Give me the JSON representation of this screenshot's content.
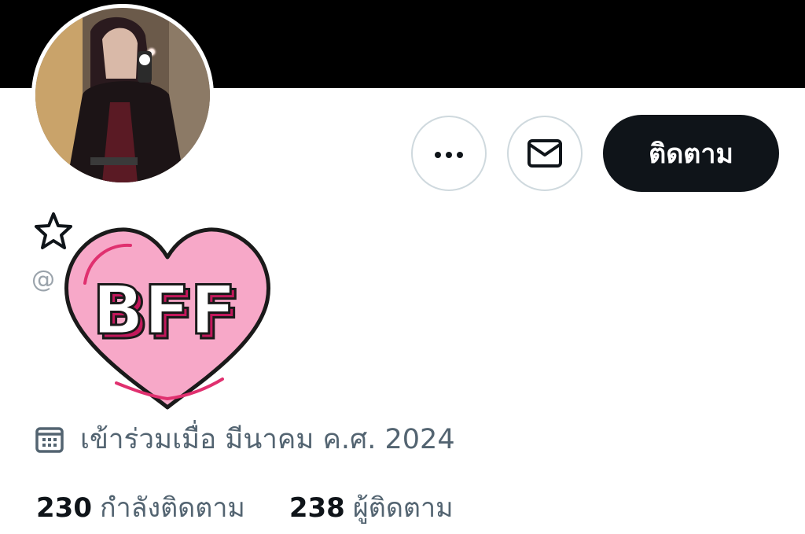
{
  "profile": {
    "handle_prefix": "@",
    "sticker_text": "BFF",
    "joined_text": "เข้าร่วมเมื่อ มีนาคม ค.ศ. 2024",
    "icons": {
      "avatar": "avatar-image",
      "star": "star-icon",
      "calendar": "calendar-icon",
      "more": "more-options-icon",
      "message": "envelope-icon"
    }
  },
  "actions": {
    "follow_label": "ติดตาม"
  },
  "stats": {
    "following": {
      "count": "230",
      "label": "กำลังติดตาม"
    },
    "followers": {
      "count": "238",
      "label": "ผู้ติดตาม"
    }
  },
  "colors": {
    "accent_dark": "#0f1419",
    "muted_text": "#536471",
    "sticker_pink": "#f7a8c8",
    "sticker_deep_pink": "#e0306f"
  }
}
